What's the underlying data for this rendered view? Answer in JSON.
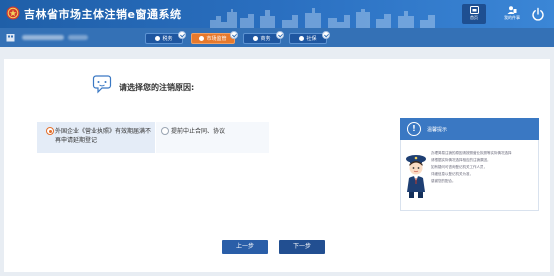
{
  "header": {
    "app_title": "吉林省市场主体注销e窗通系统",
    "home_label": "首页",
    "my_docs_label": "我的件事"
  },
  "subnav": {
    "tabs": [
      {
        "label": "税务"
      },
      {
        "label": "市场监管",
        "active": true
      },
      {
        "label": "商务"
      },
      {
        "label": "社保"
      }
    ]
  },
  "main": {
    "prompt": "请选择您的注销原因:",
    "options": [
      {
        "label": "外国企业《营业执照》有效期届满不再申请延期登记",
        "selected": true
      },
      {
        "label": "提前中止合同、协议",
        "selected": false
      }
    ],
    "tip": {
      "title": "温馨提示",
      "lines": [
        "办理简易注销的原因请按照营业执照等实际情况选择",
        "请根据实际情况选择相应的注销原因，",
        "如有疑问可咨询登记机关工作人员，",
        "详细信息以登记机关为准，",
        "感谢您的配合。"
      ]
    },
    "prev_button": "上一步",
    "next_button": "下一步"
  },
  "colors": {
    "header_bg": "#2a6fc0",
    "active_tab": "#e7792c",
    "button": "#2a5ea8",
    "radio_selected": "#e26e2b"
  },
  "icons": [
    "system-logo-icon",
    "home-icon",
    "my-docs-icon",
    "power-icon",
    "enterprise-icon",
    "question-chat-icon",
    "info-icon",
    "officer-illustration"
  ]
}
